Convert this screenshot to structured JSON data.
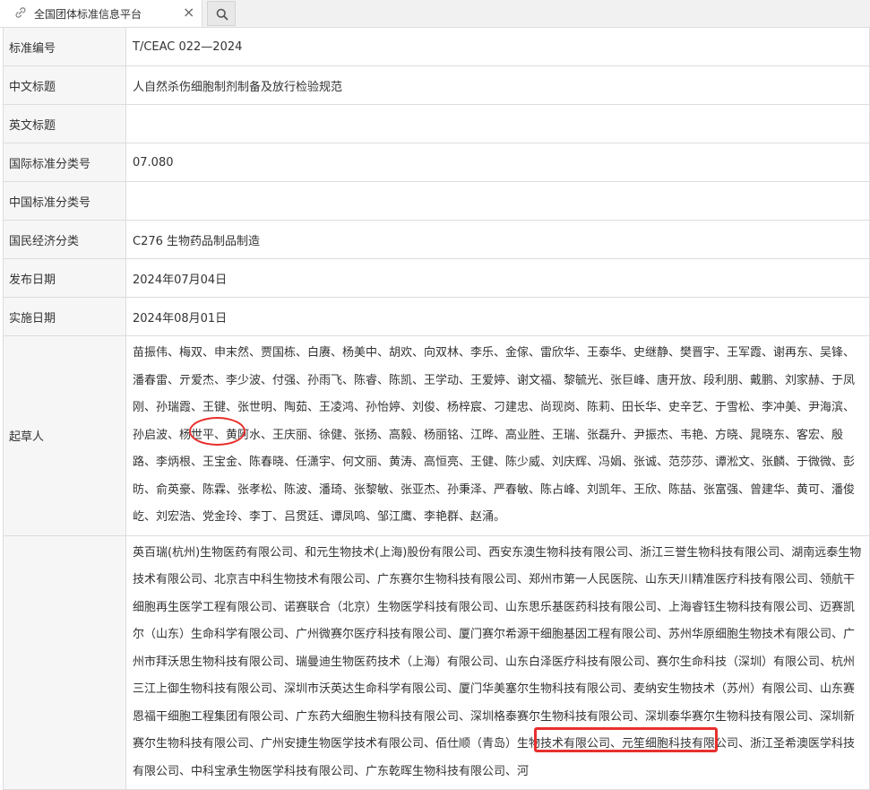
{
  "tab": {
    "title": "全国团体标准信息平台",
    "close_glyph": "×"
  },
  "rows": [
    {
      "label": "标准编号",
      "value": "T/CEAC 022—2024"
    },
    {
      "label": "中文标题",
      "value": "人自然杀伤细胞制剂制备及放行检验规范"
    },
    {
      "label": "英文标题",
      "value": ""
    },
    {
      "label": "国际标准分类号",
      "value": "07.080"
    },
    {
      "label": "中国标准分类号",
      "value": ""
    },
    {
      "label": "国民经济分类",
      "value": "C276 生物药品制品制造"
    },
    {
      "label": "发布日期",
      "value": "2024年07月04日"
    },
    {
      "label": "实施日期",
      "value": "2024年08月01日"
    }
  ],
  "drafters": {
    "label": "起草人",
    "value": "苗振伟、梅双、申末然、贾国栋、白赓、杨美中、胡欢、向双林、李乐、金傢、雷欣华、王泰华、史继静、樊晋宇、王军霞、谢再东、吴锋、潘春雷、亓爱杰、李少波、付强、孙雨飞、陈睿、陈凯、王学动、王爱婷、谢文福、黎毓光、张巨峰、唐开放、段利朋、戴鹏、刘家赫、于凤刚、孙瑞霞、王键、张世明、陶茹、王凌鸿、孙怡婷、刘俊、杨梓宸、刁建忠、尚现岗、陈莉、田长华、史辛艺、于雪松、李冲美、尹海滨、孙启波、杨世平、黄阿水、王庆丽、徐健、张扬、高毅、杨丽铭、江晔、高业胜、王瑞、张磊升、尹振杰、韦艳、方晓、晁晓东、客宏、殷路、李炳根、王宝金、陈春晓、任潇宇、何文丽、黄涛、高恒亮、王健、陈少威、刘庆辉、冯娟、张诚、范莎莎、谭淞文、张麟、于微微、彭昉、俞英豪、陈霖、张孝松、陈波、潘琦、张黎敏、张亚杰、孙秉泽、严春敏、陈占峰、刘凯年、王欣、陈喆、张富强、曾建华、黄可、潘俊屹、刘宏浩、党金玲、李丁、吕贯廷、谭凤鸣、邹江鹰、李艳群、赵涌。"
  },
  "units": {
    "label": "",
    "value": "英百瑞(杭州)生物医药有限公司、和元生物技术(上海)股份有限公司、西安东澳生物科技有限公司、浙江三誉生物科技有限公司、湖南远泰生物技术有限公司、北京吉中科生物技术有限公司、广东赛尔生物科技有限公司、郑州市第一人民医院、山东天川精准医疗科技有限公司、领航干细胞再生医学工程有限公司、诺赛联合（北京）生物医学科技有限公司、山东思乐基医药科技有限公司、上海睿钰生物科技有限公司、迈赛凯尔（山东）生命科学有限公司、广州微赛尔医疗科技有限公司、厦门赛尔希源干细胞基因工程有限公司、苏州华原细胞生物技术有限公司、广州市拜沃思生物科技有限公司、瑞曼迪生物医药技术（上海）有限公司、山东白泽医疗科技有限公司、赛尔生命科技（深圳）有限公司、杭州三江上御生物科技有限公司、深圳市沃英达生命科学有限公司、厦门华美塞尔生物科技有限公司、麦纳安生物技术（苏州）有限公司、山东赛恩福干细胞工程集团有限公司、广东药大细胞生物科技有限公司、深圳格泰赛尔生物科技有限公司、深圳泰华赛尔生物科技有限公司、深圳新赛尔生物科技有限公司、广州安捷生物医学技术有限公司、佰仕顺（青岛）生物技术有限公司、元笙细胞科技有限公司、浙江圣希澳医学科技有限公司、中科宝承生物医学科技有限公司、广东乾晖生物科技有限公司、河"
  }
}
